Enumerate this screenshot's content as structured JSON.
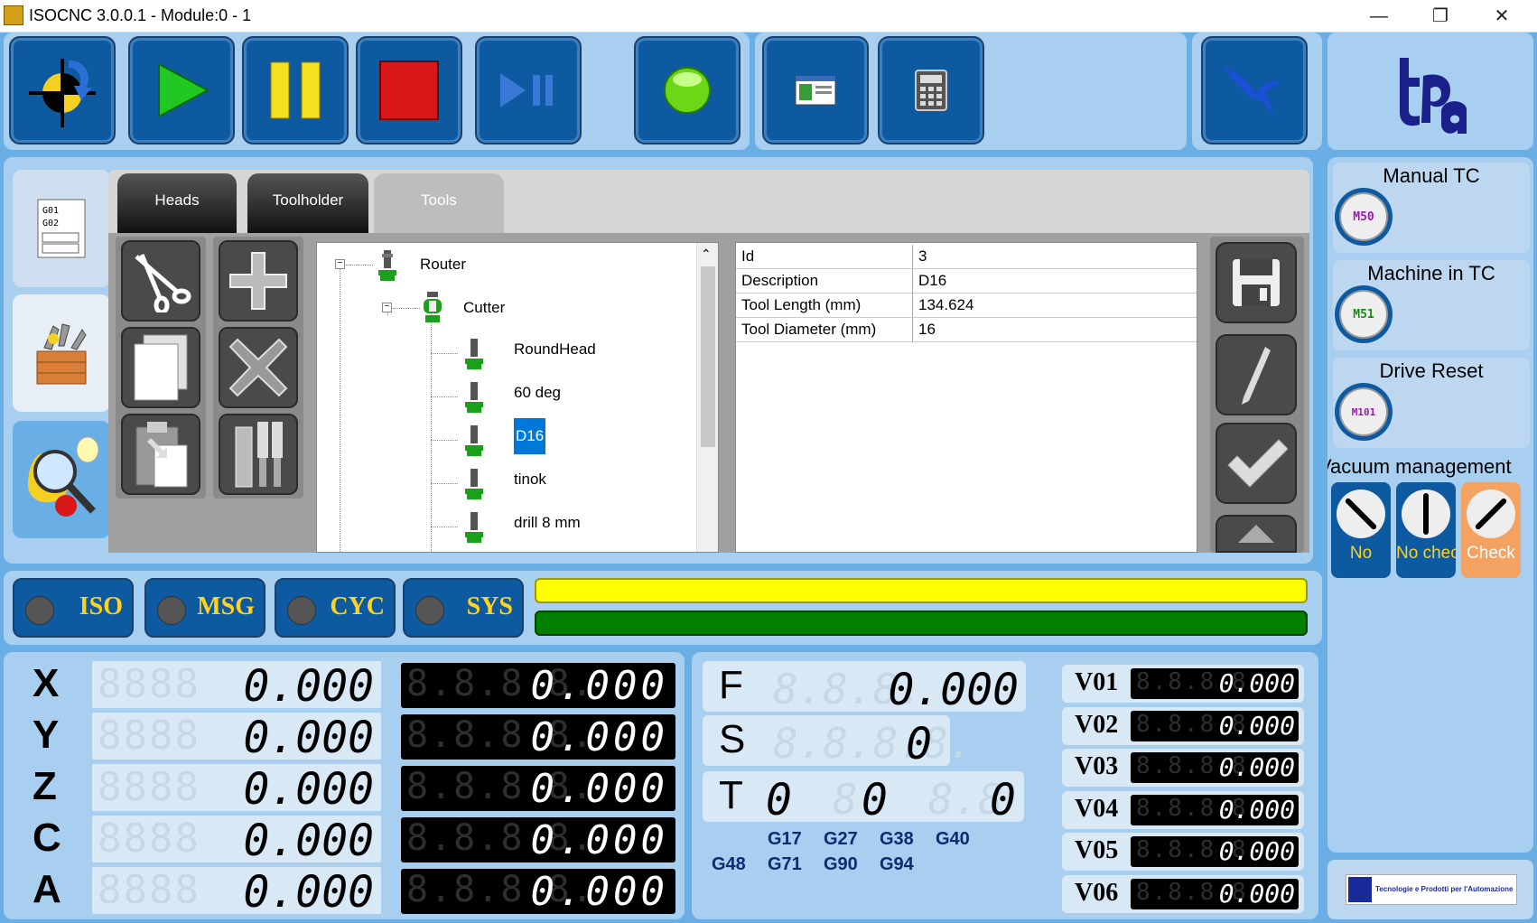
{
  "window": {
    "title": "ISOCNC 3.0.0.1 - Module:0 - 1"
  },
  "tabs": [
    "Heads",
    "Toolholder",
    "Tools"
  ],
  "tree": {
    "root": "Router",
    "group": "Cutter",
    "tools": [
      "RoundHead",
      "60 deg",
      "D16",
      "tinok",
      "drill 8 mm"
    ],
    "selected": "D16"
  },
  "properties": [
    {
      "key": "Id",
      "value": "3"
    },
    {
      "key": "Description",
      "value": "D16"
    },
    {
      "key": "Tool Length (mm)",
      "value": "134.624"
    },
    {
      "key": "Tool Diameter (mm)",
      "value": "16"
    }
  ],
  "status": [
    "ISO",
    "MSG",
    "CYC",
    "SYS"
  ],
  "axes": [
    {
      "name": "X",
      "machine": "0.000",
      "work": "0.000"
    },
    {
      "name": "Y",
      "machine": "0.000",
      "work": "0.000"
    },
    {
      "name": "Z",
      "machine": "0.000",
      "work": "0.000"
    },
    {
      "name": "C",
      "machine": "0.000",
      "work": "0.000"
    },
    {
      "name": "A",
      "machine": "0.000",
      "work": "0.000"
    }
  ],
  "feed": {
    "label": "F",
    "value": "0.000"
  },
  "spindle": {
    "label": "S",
    "value": "0"
  },
  "tool": {
    "label": "T",
    "v1": "0",
    "v2": "0",
    "v3": "0"
  },
  "gcodes_row1": [
    "G17",
    "G27",
    "G38",
    "G40"
  ],
  "gcodes_row2": [
    "G48",
    "G71",
    "G90",
    "G94"
  ],
  "variables": [
    {
      "name": "V01",
      "value": "0.000"
    },
    {
      "name": "V02",
      "value": "0.000"
    },
    {
      "name": "V03",
      "value": "0.000"
    },
    {
      "name": "V04",
      "value": "0.000"
    },
    {
      "name": "V05",
      "value": "0.000"
    },
    {
      "name": "V06",
      "value": "0.000"
    }
  ],
  "right": {
    "manual_tc": {
      "title": "Manual TC",
      "code": "M50"
    },
    "machine_tc": {
      "title": "Machine in TC",
      "code": "M51"
    },
    "drive_reset": {
      "title": "Drive Reset",
      "code": "M101"
    },
    "vacuum": {
      "title": "Vacuum management",
      "options": [
        "No",
        "No check",
        "Check"
      ]
    }
  },
  "brand": {
    "logo": "tpa",
    "footer": "Tecnologie e Prodotti per l'Automazione"
  },
  "colors": {
    "toolbar": "#0d5aa0",
    "status_yellow": "#ffff00",
    "status_green": "#008000",
    "selection": "#0078d7",
    "vacuum_active": "#f4a261"
  }
}
